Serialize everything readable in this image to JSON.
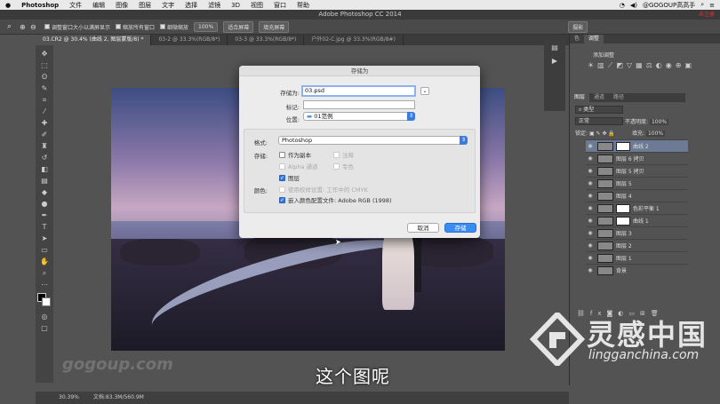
{
  "menubar": {
    "apple_icon": "apple-icon",
    "app": "Photoshop",
    "items": [
      "文件",
      "编辑",
      "图像",
      "图层",
      "文字",
      "选择",
      "滤镜",
      "3D",
      "视图",
      "窗口",
      "帮助"
    ],
    "user": "@GOGOUP高高手"
  },
  "window": {
    "title": "Adobe Photoshop CC 2014",
    "note": "未注册"
  },
  "options": {
    "opt1": "调整窗口大小以满屏显示",
    "opt2": "缩放所有窗口",
    "opt3": "细微缩放",
    "zoom": "100%",
    "fit": "适合屏幕",
    "fill": "填充屏幕",
    "workspace": "摄影"
  },
  "tabs": [
    "03.CR2 @ 30.4% (曲线 2, 图层蒙版/8) *",
    "03-2 @ 33.3%(RGB/8*)",
    "03-3 @ 33.3%(RGB/8*)",
    "户外02-C.jpg @ 33.3%(RGB/8#)"
  ],
  "dialog": {
    "title": "存储为",
    "save_as_label": "存储为:",
    "filename": "03.psd",
    "tags_label": "标记:",
    "location_label": "位置:",
    "location": "01范例",
    "format_label": "格式:",
    "format": "Photoshop",
    "save_label": "存储:",
    "as_copy": "作为副本",
    "notes": "注释",
    "alpha": "Alpha 通道",
    "spot": "专色",
    "layers": "图层",
    "color_label": "颜色:",
    "proof": "使用校样设置: 工作中的 CMYK",
    "embed": "嵌入颜色配置文件: Adobe RGB (1998)",
    "cancel": "取消",
    "save": "存储"
  },
  "panel": {
    "tabs": [
      "色",
      "调整"
    ],
    "add_adjust": "添加调整",
    "layer_tabs": [
      "图层",
      "通道",
      "路径"
    ],
    "kind": "类型",
    "blend": "正常",
    "opacity_label": "不透明度:",
    "opacity": "100%",
    "lock_label": "锁定:",
    "fill_label": "填充:",
    "fill": "100%",
    "layers": [
      {
        "name": "曲线 2",
        "selected": true
      },
      {
        "name": "图层 6 拷贝",
        "selected": false
      },
      {
        "name": "图层 5 拷贝",
        "selected": false
      },
      {
        "name": "图层 5",
        "selected": false
      },
      {
        "name": "图层 4",
        "selected": false
      },
      {
        "name": "色彩平衡 1",
        "selected": false
      },
      {
        "name": "曲线 1",
        "selected": false
      },
      {
        "name": "图层 3",
        "selected": false
      },
      {
        "name": "图层 2",
        "selected": false
      },
      {
        "name": "图层 1",
        "selected": false
      },
      {
        "name": "背景",
        "selected": false
      }
    ]
  },
  "status": {
    "zoom": "30.39%",
    "doc": "文档:83.3M/560.9M"
  },
  "subtitle": "这个图呢",
  "watermark": {
    "site": "gogoup.com",
    "cn": "灵感中国",
    "en": "lingganchina.com"
  }
}
